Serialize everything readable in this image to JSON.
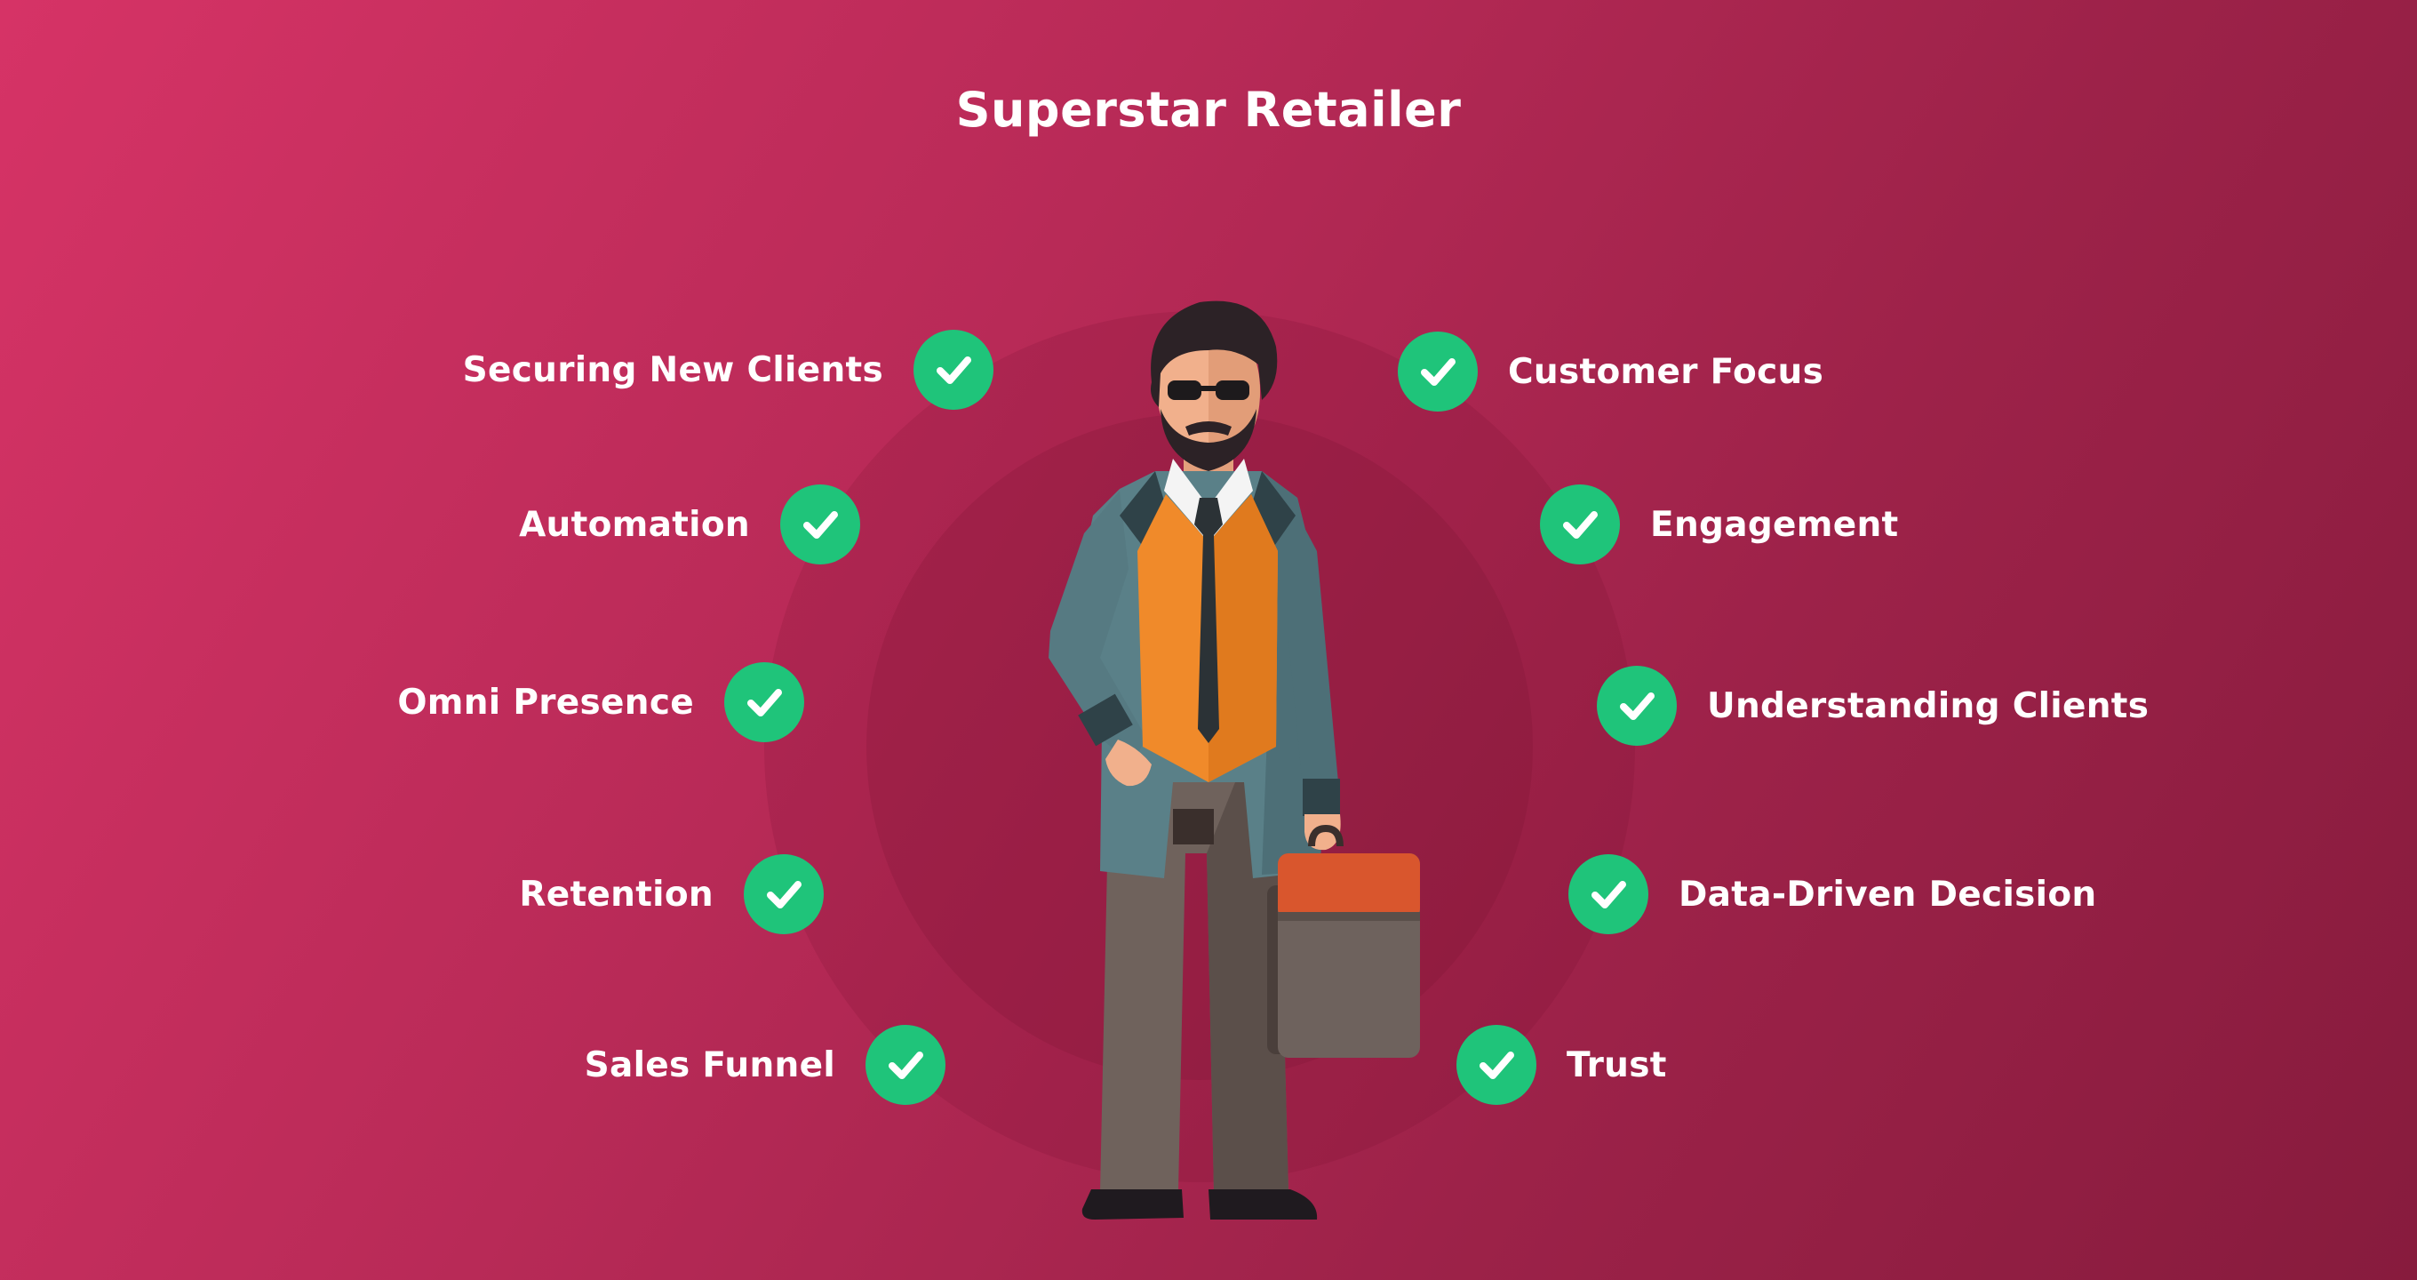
{
  "title": "Superstar Retailer",
  "colors": {
    "background_start": "#d63366",
    "background_end": "#871b3d",
    "check": "#1fc47a",
    "text": "#ffffff"
  },
  "left_items": [
    {
      "label": "Securing New Clients",
      "icon": "check-icon"
    },
    {
      "label": "Automation",
      "icon": "check-icon"
    },
    {
      "label": "Omni Presence",
      "icon": "check-icon"
    },
    {
      "label": "Retention",
      "icon": "check-icon"
    },
    {
      "label": "Sales Funnel",
      "icon": "check-icon"
    }
  ],
  "right_items": [
    {
      "label": "Customer Focus",
      "icon": "check-icon"
    },
    {
      "label": "Engagement",
      "icon": "check-icon"
    },
    {
      "label": "Understanding Clients",
      "icon": "check-icon"
    },
    {
      "label": "Data-Driven Decision",
      "icon": "check-icon"
    },
    {
      "label": "Trust",
      "icon": "check-icon"
    }
  ],
  "illustration": {
    "icon": "businessman-with-briefcase-icon"
  }
}
